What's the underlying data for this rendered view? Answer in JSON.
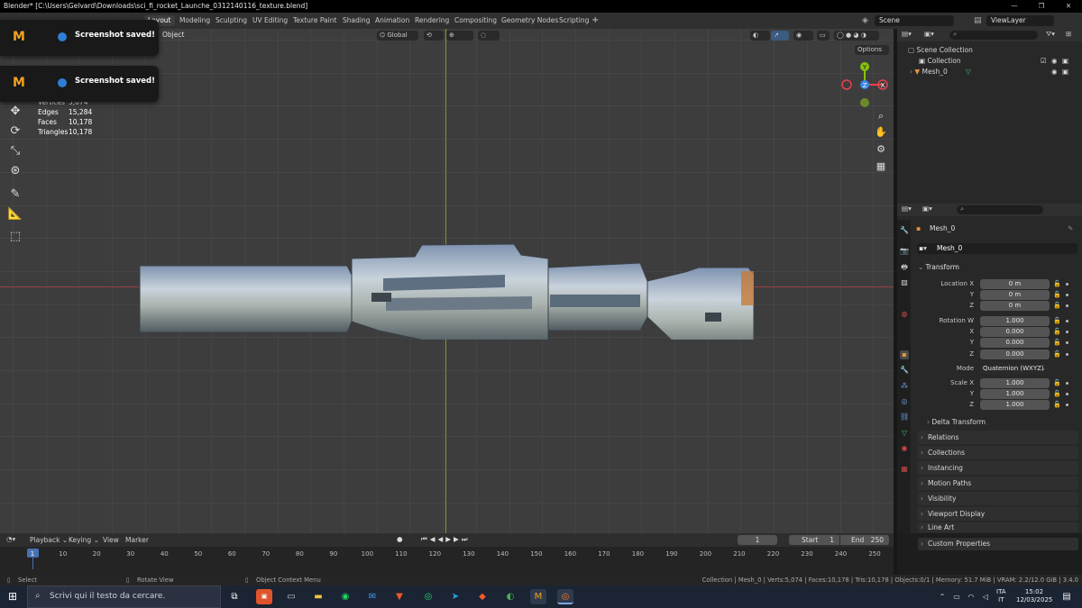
{
  "window": {
    "title": "Blender* [C:\\Users\\Gelvard\\Downloads\\sci_fi_rocket_Launche_0312140116_texture.blend]"
  },
  "workspace_tabs": [
    "Layout",
    "Modeling",
    "Sculpting",
    "UV Editing",
    "Texture Paint",
    "Shading",
    "Animation",
    "Rendering",
    "Compositing",
    "Geometry Nodes",
    "Scripting"
  ],
  "topbar": {
    "scene": "Scene",
    "view_layer": "ViewLayer",
    "add": "+"
  },
  "viewport": {
    "mode_label": "Object",
    "transform_orientation": "Global",
    "options": "Options",
    "stats": [
      {
        "label": "Vertices",
        "value": "5,074"
      },
      {
        "label": "Edges",
        "value": "15,284"
      },
      {
        "label": "Faces",
        "value": "10,178"
      },
      {
        "label": "Triangles",
        "value": "10,178"
      }
    ],
    "gizmo": {
      "x": "X",
      "y": "Y",
      "z": "Z"
    }
  },
  "toasts": [
    {
      "logo": "M",
      "text": "Screenshot saved!"
    },
    {
      "logo": "M",
      "text": "Screenshot saved!"
    }
  ],
  "outliner": {
    "root": "Scene Collection",
    "collection": "Collection",
    "object": "Mesh_0"
  },
  "properties": {
    "object_name": "Mesh_0",
    "data_name": "Mesh_0",
    "transform_header": "Transform",
    "location": {
      "label_x": "Location X",
      "x": "0 m",
      "y": "0 m",
      "z": "0 m"
    },
    "rotation": {
      "label_w": "Rotation W",
      "w": "1.000",
      "x": "0.000",
      "y": "0.000",
      "z": "0.000"
    },
    "mode": {
      "label": "Mode",
      "value": "Quaternion (WXYZ)"
    },
    "scale": {
      "label_x": "Scale X",
      "x": "1.000",
      "y": "1.000",
      "z": "1.000"
    },
    "axis_labels": {
      "y": "Y",
      "z": "Z",
      "x": "X"
    },
    "delta_transform": "Delta Transform",
    "panels": [
      "Relations",
      "Collections",
      "Instancing",
      "Motion Paths",
      "Visibility",
      "Viewport Display",
      "Line Art",
      "Custom Properties"
    ]
  },
  "timeline": {
    "menu": [
      "Playback",
      "Keying",
      "View",
      "Marker"
    ],
    "current_frame": "1",
    "start_label": "Start",
    "start": "1",
    "end_label": "End",
    "end": "250",
    "ruler": [
      "1",
      "10",
      "20",
      "30",
      "40",
      "50",
      "60",
      "70",
      "80",
      "90",
      "100",
      "110",
      "120",
      "130",
      "140",
      "150",
      "160",
      "170",
      "180",
      "190",
      "200",
      "210",
      "220",
      "230",
      "240",
      "250"
    ]
  },
  "statusbar": {
    "select": "Select",
    "rotate": "Rotate View",
    "context": "Object Context Menu",
    "info": "Collection | Mesh_0 | Verts:5,074 | Faces:10,178 | Tris:10,178 | Objects:0/1 | Memory: 51.7 MiB | VRAM: 2.2/12.0 GiB | 3.4.0"
  },
  "taskbar": {
    "search_placeholder": "Scrivi qui il testo da cercare.",
    "lang": "ITA",
    "lang2": "IT",
    "time": "15:02",
    "date": "12/03/2025"
  },
  "colors": {
    "accent": "#4772b3",
    "x_axis": "#e8424c",
    "y_axis": "#88c20e",
    "z_axis": "#3a86e8",
    "toast_logo": "#f1a31e"
  }
}
